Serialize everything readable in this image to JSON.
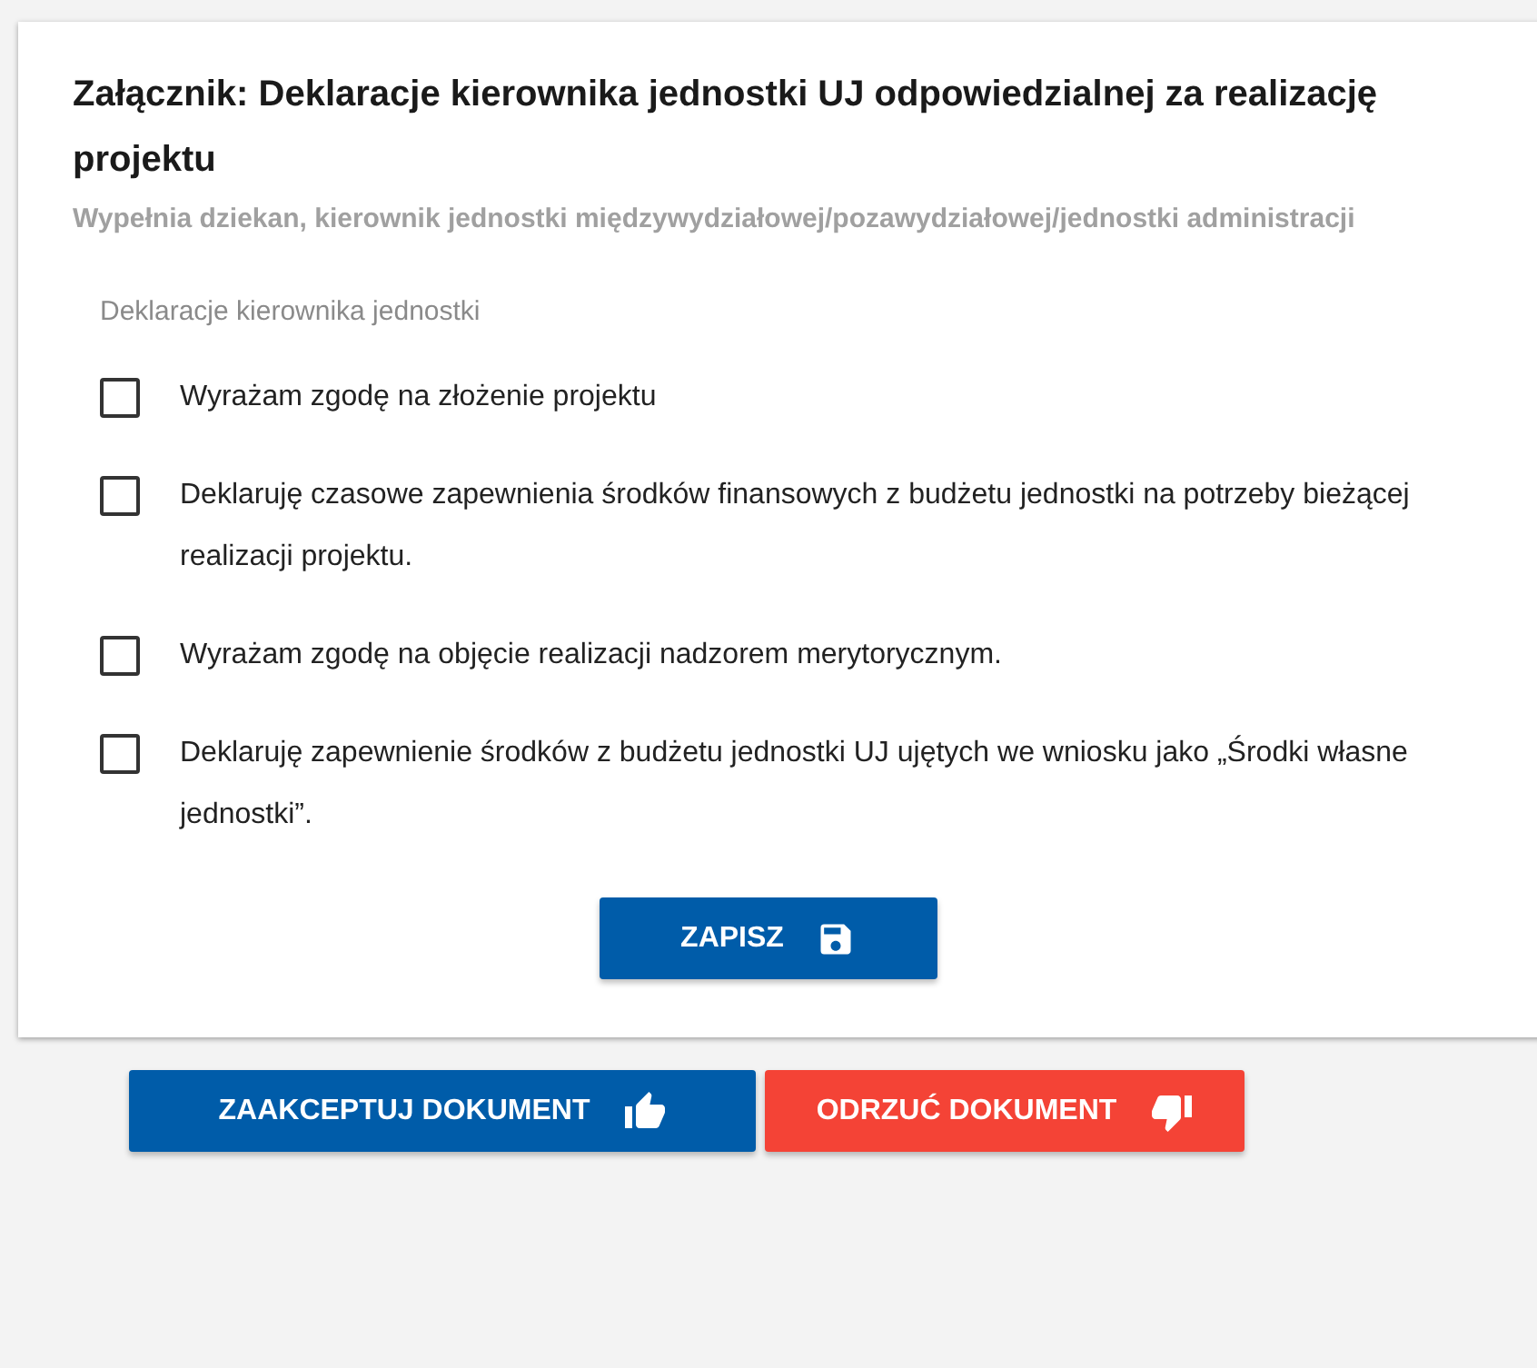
{
  "card": {
    "title": "Załącznik: Deklaracje kierownika jednostki UJ odpowiedzialnej za realizację projektu",
    "subtitle": "Wypełnia dziekan, kierownik jednostki międzywydziałowej/pozawydziałowej/jednostki administracji",
    "section_label": "Deklaracje kierownika jednostki",
    "declarations": [
      {
        "label": "Wyrażam zgodę na złożenie projektu",
        "checked": false
      },
      {
        "label": "Deklaruję czasowe zapewnienia środków finansowych z budżetu jednostki na potrzeby bieżącej realizacji projektu.",
        "checked": false
      },
      {
        "label": "Wyrażam zgodę na objęcie realizacji nadzorem merytorycznym.",
        "checked": false
      },
      {
        "label": "Deklaruję zapewnienie środków z budżetu jednostki UJ ujętych we wniosku jako „Środki własne jednostki”.",
        "checked": false
      }
    ],
    "save_button": "ZAPISZ"
  },
  "actions": [
    {
      "label": "ZAAKCEPTUJ DOKUMENT",
      "kind": "accept"
    },
    {
      "label": "ODRZUĆ DOKUMENT",
      "kind": "reject"
    }
  ]
}
